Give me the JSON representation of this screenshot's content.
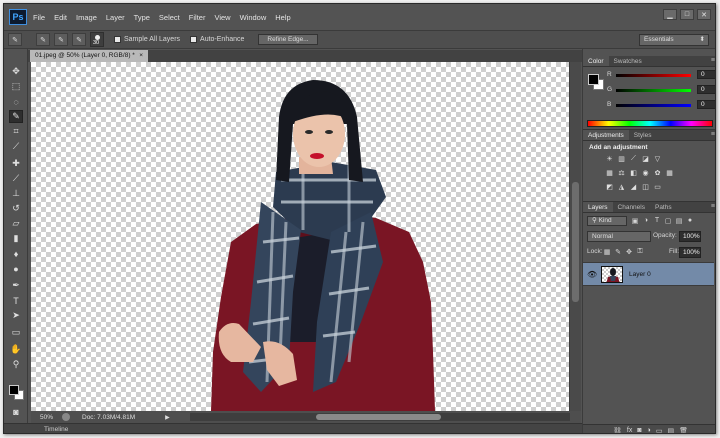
{
  "app": {
    "logo": "Ps"
  },
  "menu": [
    "File",
    "Edit",
    "Image",
    "Layer",
    "Type",
    "Select",
    "Filter",
    "View",
    "Window",
    "Help"
  ],
  "window_controls": [
    "▁",
    "□",
    "✕"
  ],
  "options": {
    "brush_size": "30",
    "sample_all_layers": "Sample All Layers",
    "auto_enhance": "Auto-Enhance",
    "refine_edge": "Refine Edge...",
    "workspace": "Essentials"
  },
  "document": {
    "tab_title": "01.jpeg @ 50% (Layer 0, RGB/8) *",
    "zoom": "50%",
    "doc_size": "Doc: 7.03M/4.81M"
  },
  "timeline": {
    "label": "Timeline"
  },
  "color_panel": {
    "tabs": [
      "Color",
      "Swatches"
    ],
    "channels": [
      {
        "label": "R",
        "value": "0"
      },
      {
        "label": "G",
        "value": "0"
      },
      {
        "label": "B",
        "value": "0"
      }
    ]
  },
  "adjustments_panel": {
    "tabs": [
      "Adjustments",
      "Styles"
    ],
    "title": "Add an adjustment"
  },
  "layers_panel": {
    "tabs": [
      "Layers",
      "Channels",
      "Paths"
    ],
    "kind": "Kind",
    "blend_mode": "Normal",
    "opacity_label": "Opacity:",
    "opacity": "100%",
    "lock_label": "Lock:",
    "fill_label": "Fill:",
    "fill": "100%",
    "layers": [
      {
        "name": "Layer 0",
        "visible": true
      }
    ]
  },
  "colors": {
    "ui_bg": "#535353",
    "canvas_check": "#cfcfcf",
    "layer_selected": "#738aa8",
    "coat": "#7a1524"
  }
}
